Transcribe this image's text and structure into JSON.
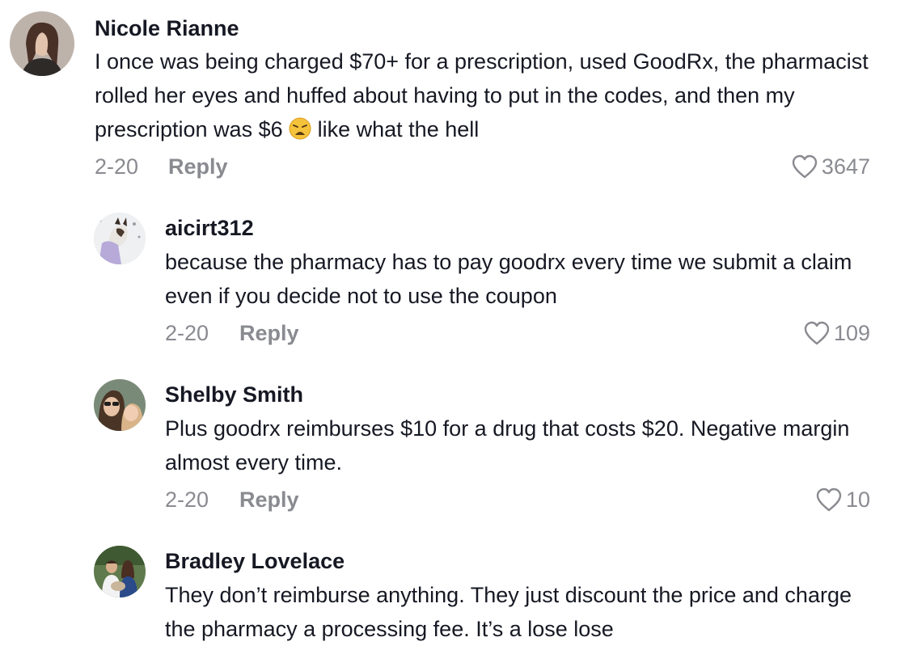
{
  "comments": [
    {
      "username": "Nicole Rianne",
      "text_before_emoji": "I once was being charged $70+ for a prescription, used GoodRx, the pharmacist rolled her eyes and huffed about having to put in the codes, and then my prescription was $6 ",
      "emoji": "weary-face-emoji",
      "text_after_emoji": " like what the hell",
      "date": "2-20",
      "reply_label": "Reply",
      "likes": "3647"
    },
    {
      "username": "aicirt312",
      "text": "because the pharmacy has to pay goodrx every time we submit a claim even if you decide not to use the coupon",
      "date": "2-20",
      "reply_label": "Reply",
      "likes": "109"
    },
    {
      "username": "Shelby Smith",
      "text": "Plus goodrx reimburses $10 for a drug that costs $20. Negative margin almost every time.",
      "date": "2-20",
      "reply_label": "Reply",
      "likes": "10"
    },
    {
      "username": "Bradley Lovelace",
      "text": "They don’t reimburse anything. They just discount the price and charge the pharmacy a processing fee. It’s a lose lose"
    }
  ],
  "icons": {
    "like": "heart-outline-icon",
    "emoji": "weary-face-emoji"
  },
  "colors": {
    "text": "#161823",
    "muted": "#8a8b91"
  }
}
